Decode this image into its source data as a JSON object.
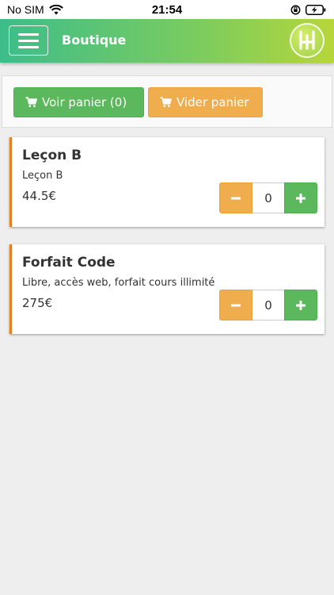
{
  "status_bar": {
    "carrier": "No SIM",
    "time": "21:54"
  },
  "header": {
    "title": "Boutique"
  },
  "toolbar": {
    "view_cart_label": "Voir panier (0)",
    "empty_cart_label": "Vider panier"
  },
  "products": [
    {
      "name": "Leçon B",
      "description": "Leçon B",
      "price": "44.5€",
      "quantity": "0"
    },
    {
      "name": "Forfait Code",
      "description": "Libre, accès web, forfait cours illimité",
      "price": "275€",
      "quantity": "0"
    }
  ],
  "colors": {
    "accent_green": "#5cb85c",
    "accent_orange": "#f0ad4e",
    "card_border": "#e67e22"
  },
  "icons": {
    "cart": "cart-icon",
    "menu": "hamburger-menu-icon",
    "wifi": "wifi-icon",
    "battery": "battery-charging-icon",
    "orientation_lock": "orientation-lock-icon"
  }
}
